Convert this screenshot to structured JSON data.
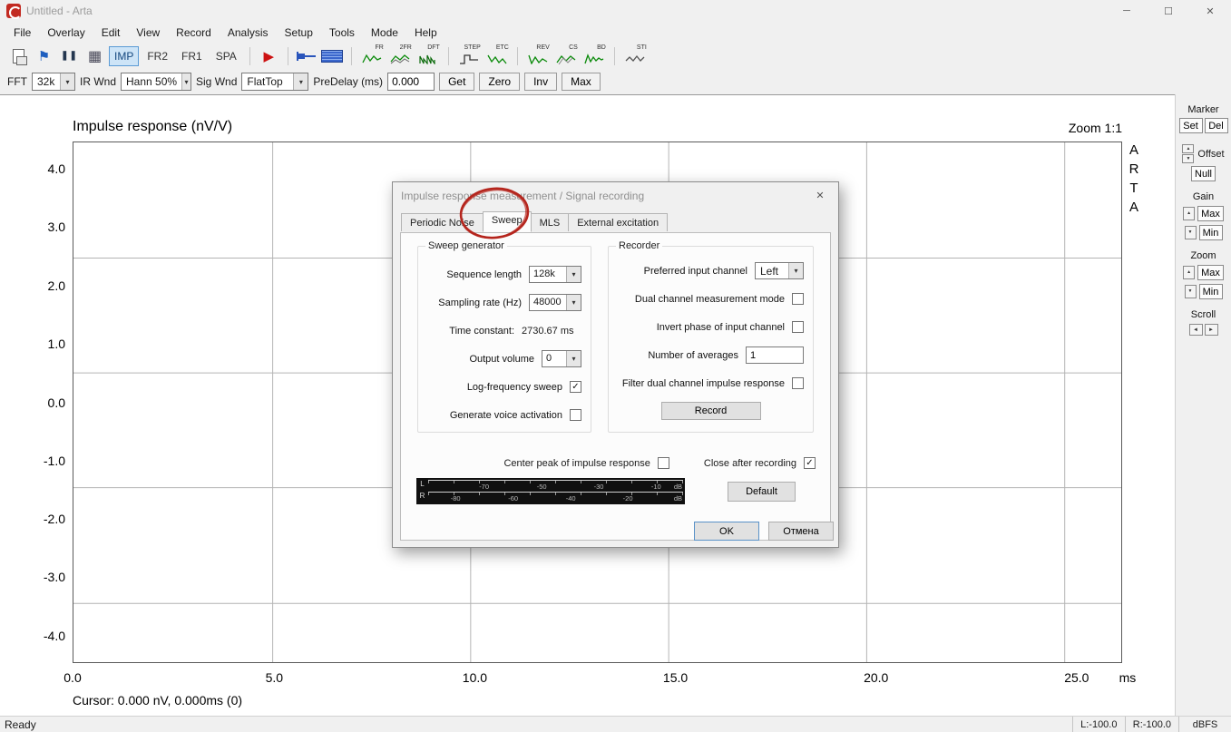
{
  "window": {
    "title": "Untitled - Arta"
  },
  "icons": {
    "dropdown": "▾",
    "up": "▲",
    "down": "▼",
    "left": "◄",
    "right": "►",
    "check": "✓",
    "play": "▶",
    "pause": "❚❚",
    "grid": "▦",
    "flag": "⚑",
    "minimize": "─",
    "maximize": "☐",
    "close": "✕"
  },
  "menu": {
    "items": [
      "File",
      "Overlay",
      "Edit",
      "View",
      "Record",
      "Analysis",
      "Setup",
      "Tools",
      "Mode",
      "Help"
    ]
  },
  "toolbar": {
    "modes": [
      "IMP",
      "FR2",
      "FR1",
      "SPA"
    ],
    "active_mode": "IMP",
    "analysis_icons": [
      "FR",
      "2FR",
      "DFT",
      "STEP",
      "ETC",
      "REV",
      "CS",
      "BD",
      "STI"
    ]
  },
  "controls_bar": {
    "fft_label": "FFT",
    "fft_value": "32k",
    "ir_wnd_label": "IR Wnd",
    "ir_wnd_value": "Hann 50%",
    "sig_wnd_label": "Sig Wnd",
    "sig_wnd_value": "FlatTop",
    "predelay_label": "PreDelay (ms)",
    "predelay_value": "0.000",
    "get": "Get",
    "zero": "Zero",
    "inv": "Inv",
    "max": "Max"
  },
  "chart": {
    "title": "Impulse response (nV/V)",
    "zoom": "Zoom 1:1",
    "y_ticks": [
      "4.0",
      "3.0",
      "2.0",
      "1.0",
      "0.0",
      "-1.0",
      "-2.0",
      "-3.0",
      "-4.0"
    ],
    "x_ticks": [
      "0.0",
      "5.0",
      "10.0",
      "15.0",
      "20.0",
      "25.0"
    ],
    "x_unit": "ms",
    "cursor": "Cursor: 0.000 nV, 0.000ms (0)"
  },
  "chart_data": {
    "type": "line",
    "title": "Impulse response (nV/V)",
    "xlabel": "ms",
    "ylabel": "nV/V",
    "xlim": [
      0,
      26.4
    ],
    "ylim": [
      -4.5,
      4.5
    ],
    "x_tick_values": [
      0,
      5,
      10,
      15,
      20,
      25
    ],
    "y_tick_values": [
      4,
      3,
      2,
      1,
      0,
      -1,
      -2,
      -3,
      -4
    ],
    "series": [],
    "note": "empty plot, no waveform recorded yet"
  },
  "side_panel": {
    "arta": [
      "A",
      "R",
      "T",
      "A"
    ],
    "marker_label": "Marker",
    "set": "Set",
    "del": "Del",
    "offset_label": "Offset",
    "null": "Null",
    "gain_label": "Gain",
    "gain_max": "Max",
    "gain_min": "Min",
    "zoom_label": "Zoom",
    "zoom_max": "Max",
    "zoom_min": "Min",
    "scroll_label": "Scroll"
  },
  "dialog": {
    "title": "Impulse response measurement / Signal recording",
    "tabs": [
      "Periodic Noise",
      "Sweep",
      "MLS",
      "External excitation"
    ],
    "active_tab": "Sweep",
    "sweep_group": {
      "title": "Sweep generator",
      "sequence_length_label": "Sequence length",
      "sequence_length_value": "128k",
      "sampling_rate_label": "Sampling rate (Hz)",
      "sampling_rate_value": "48000",
      "time_constant_label": "Time constant:",
      "time_constant_value": "2730.67 ms",
      "output_volume_label": "Output volume",
      "output_volume_value": "0",
      "log_sweep_label": "Log-frequency sweep",
      "log_sweep_checked": true,
      "voice_activation_label": "Generate voice activation",
      "voice_activation_checked": false
    },
    "recorder_group": {
      "title": "Recorder",
      "input_channel_label": "Preferred input channel",
      "input_channel_value": "Left",
      "dual_channel_label": "Dual channel measurement mode",
      "dual_channel_checked": false,
      "invert_phase_label": "Invert phase of input channel",
      "invert_phase_checked": false,
      "averages_label": "Number of averages",
      "averages_value": "1",
      "filter_dual_label": "Filter dual channel impulse response",
      "filter_dual_checked": false,
      "record": "Record"
    },
    "center_peak_label": "Center peak of impulse response",
    "center_peak_checked": false,
    "close_after_label": "Close after recording",
    "close_after_checked": true,
    "meter": {
      "l": "L",
      "r": "R",
      "top_scale": [
        "-70",
        "-50",
        "-30",
        "-10",
        "dB"
      ],
      "bottom_scale": [
        "-80",
        "-60",
        "-40",
        "-20",
        "dB"
      ]
    },
    "default": "Default",
    "ok": "OK",
    "cancel": "Отмена"
  },
  "status_bar": {
    "ready": "Ready",
    "left_level": "L:-100.0",
    "right_level": "R:-100.0",
    "unit": "dBFS"
  }
}
